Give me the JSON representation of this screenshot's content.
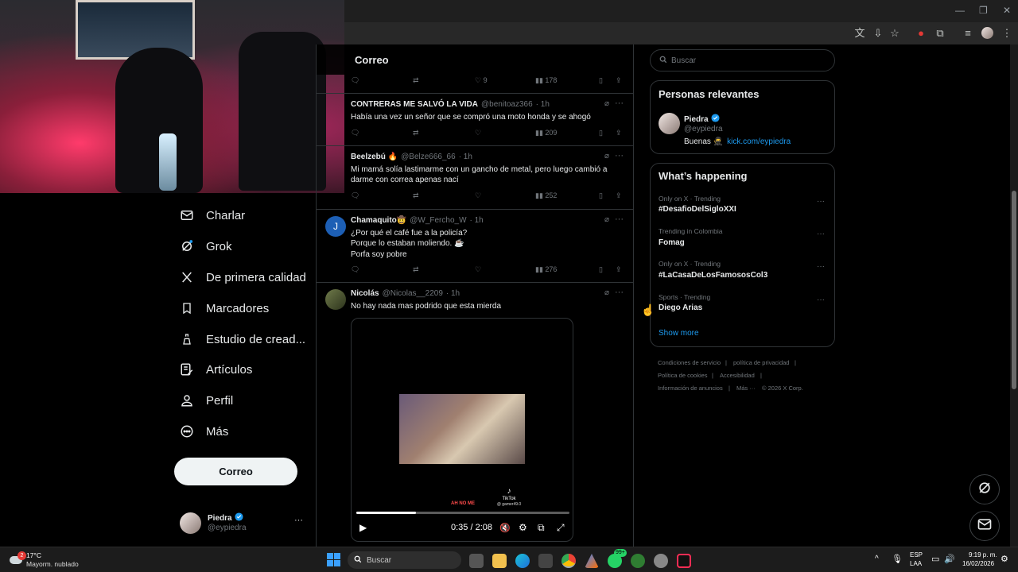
{
  "browser": {
    "minimize": "—",
    "restore": "❐",
    "close": "✕"
  },
  "nav": {
    "items": [
      {
        "label": "Charlar",
        "icon": "mail-icon"
      },
      {
        "label": "Grok",
        "icon": "grok-icon"
      },
      {
        "label": "De primera calidad",
        "icon": "x-logo-icon"
      },
      {
        "label": "Marcadores",
        "icon": "bookmark-icon"
      },
      {
        "label": "Estudio de cread...",
        "icon": "creator-studio-icon"
      },
      {
        "label": "Artículos",
        "icon": "articles-icon"
      },
      {
        "label": "Perfil",
        "icon": "person-icon"
      },
      {
        "label": "Más",
        "icon": "more-circle-icon"
      }
    ],
    "post_button": "Correo",
    "account": {
      "name": "Piedra",
      "handle": "@eypiedra",
      "more": "···"
    }
  },
  "timeline": {
    "header_title": "Correo",
    "top_actions": {
      "likes": "9",
      "views": "178"
    },
    "tweets": [
      {
        "name": "CONTRERAS ME SALVÓ LA VIDA",
        "handle": "@benitoaz366",
        "time": "· 1h",
        "text": "Había una vez un señor que se compró una moto honda y se ahogó",
        "views": "209"
      },
      {
        "name": "Beelzebú 🔥",
        "handle": "@Belze666_66",
        "time": "· 1h",
        "text": "Mi mamá solía lastimarme con un gancho de metal, pero luego cambió a darme con correa apenas nací",
        "views": "252"
      },
      {
        "name": "Chamaquito🤠",
        "handle": "@W_Fercho_W",
        "time": "· 1h",
        "avatar_letter": "J",
        "lines": [
          "¿Por qué el café fue a la policía?",
          "Porque lo estaban moliendo. ☕",
          "Porfa soy pobre"
        ],
        "views": "276"
      },
      {
        "name": "Nicolás",
        "handle": "@Nicolas__2209",
        "time": "· 1h",
        "text": "No hay nada mas podrido que esta mierda",
        "video": {
          "time": "0:35 / 2:08",
          "progress": 0.28,
          "watermark_left": "AH NO ME",
          "watermark_brand": "TikTok",
          "watermark_user": "@ gamer49.0"
        }
      }
    ]
  },
  "right": {
    "search_placeholder": "Buscar",
    "relevant": {
      "title": "Personas relevantes",
      "name": "Piedra",
      "handle": "@eypiedra",
      "bio_text": "Buenas 🥷",
      "bio_link": "kick.com/eypiedra"
    },
    "happening": {
      "title": "What’s happening",
      "trends": [
        {
          "meta": "Only on X · Trending",
          "name": "#DesafioDelSigloXXI"
        },
        {
          "meta": "Trending in Colombia",
          "name": "Fomag"
        },
        {
          "meta": "Only on X · Trending",
          "name": "#LaCasaDeLosFamososCol3"
        },
        {
          "meta": "Sports · Trending",
          "name": "Diego Arias"
        }
      ],
      "show_more": "Show more"
    },
    "footer": [
      "Condiciones de servicio",
      "|",
      "política de privacidad",
      "|",
      "Política de cookies",
      "|",
      "Accesibilidad",
      "|",
      "Información de anuncios",
      "|",
      "Más ···",
      "© 2026 X Corp."
    ]
  },
  "taskbar": {
    "weather_temp": "17°C",
    "weather_desc": "Mayorm. nublado",
    "weather_badge": "2",
    "search_label": "Buscar",
    "whatsapp_badge": "99+",
    "lang_top": "ESP",
    "lang_bottom": "LAA",
    "time": "9:19 p. m.",
    "date": "16/02/2026"
  },
  "colors": {
    "accent": "#1d9bf0",
    "background": "#000000",
    "muted": "#71767b",
    "border": "#2f3336"
  }
}
